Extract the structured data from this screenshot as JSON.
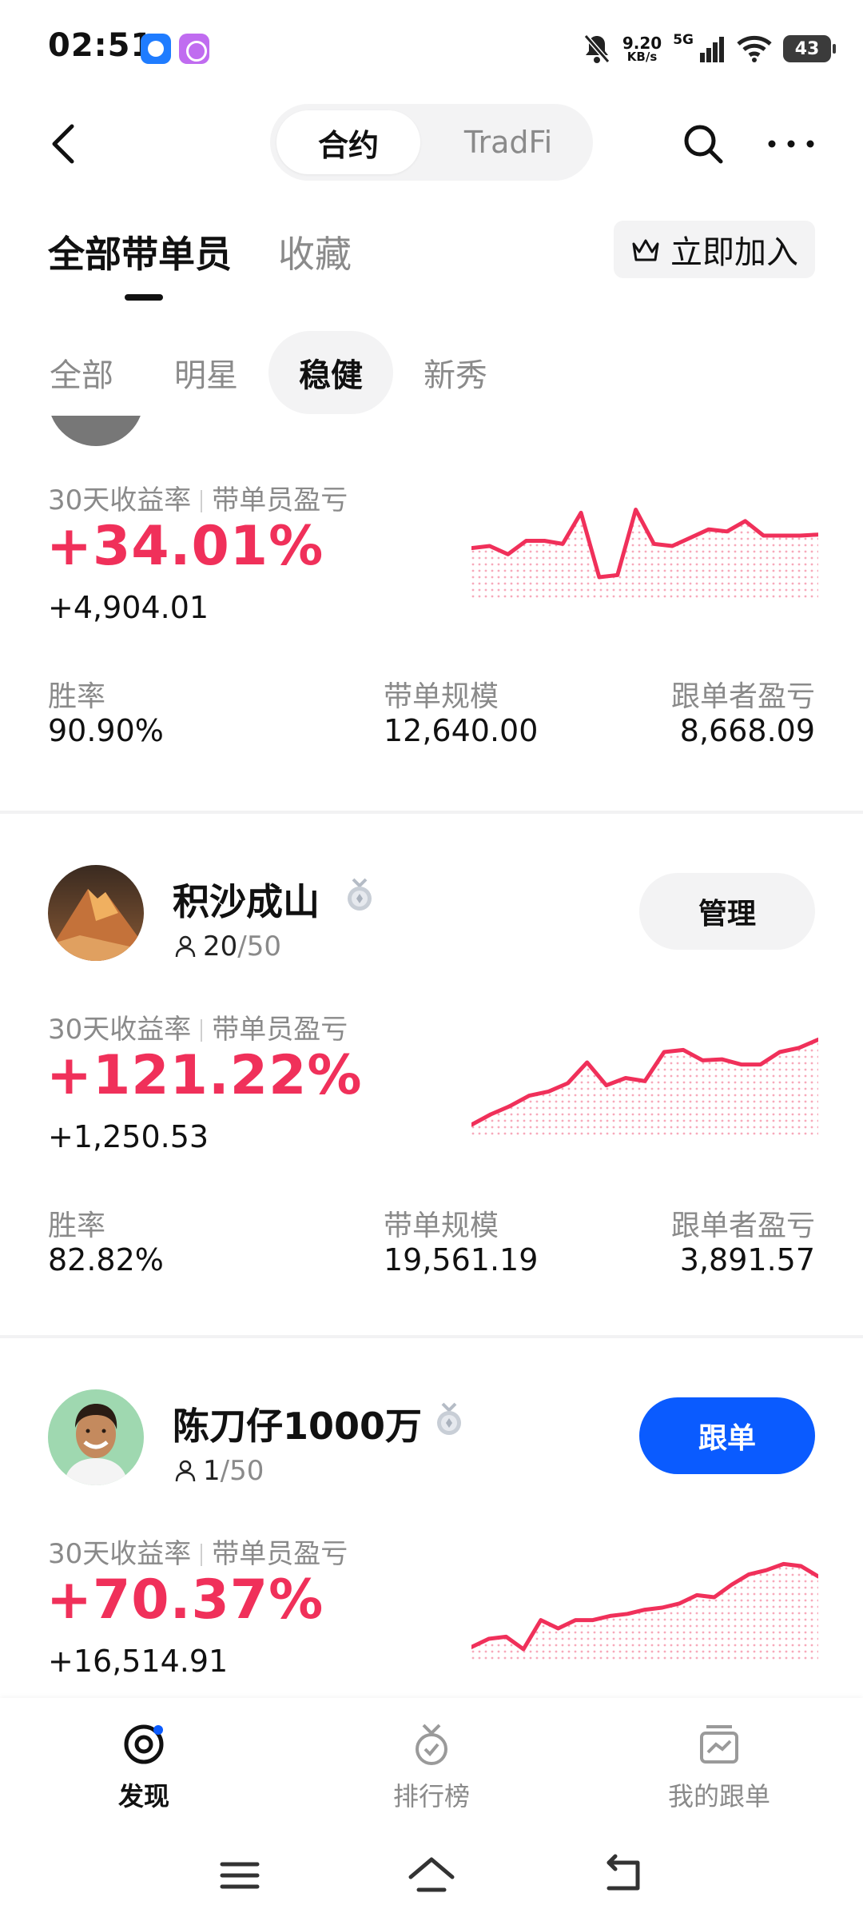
{
  "status_bar": {
    "time": "02:51",
    "net_speed_value": "9.20",
    "net_speed_unit": "KB/s",
    "network": "5G",
    "battery": "43"
  },
  "header": {
    "segments": [
      "合约",
      "TradFi"
    ],
    "active_segment": "合约"
  },
  "tabs": {
    "main": [
      "全部带单员",
      "收藏"
    ],
    "join_label": "立即加入"
  },
  "filters": [
    "全部",
    "明星",
    "稳健",
    "新秀"
  ],
  "labels": {
    "roi_label": "30天收益率",
    "pnl_label": "带单员盈亏",
    "win_rate": "胜率",
    "aum": "带单规模",
    "follower_pnl": "跟单者盈亏"
  },
  "traders": [
    {
      "roi": "+34.01%",
      "pnl": "+4,904.01",
      "win_rate": "90.90%",
      "aum": "12,640.00",
      "follower_pnl": "8,668.09",
      "spark": [
        52,
        50,
        58,
        45,
        45,
        48,
        18,
        80,
        78,
        15,
        48,
        50,
        42,
        34,
        36,
        26,
        40,
        40,
        40,
        39
      ]
    },
    {
      "name": "积沙成山",
      "followers": "20",
      "max_followers": "/50",
      "button": "管理",
      "roi": "+121.22%",
      "pnl": "+1,250.53",
      "win_rate": "82.82%",
      "aum": "19,561.19",
      "follower_pnl": "3,891.57",
      "spark": [
        90,
        80,
        72,
        62,
        58,
        50,
        30,
        52,
        45,
        48,
        20,
        18,
        28,
        27,
        32,
        32,
        20,
        16,
        8
      ]
    },
    {
      "name": "陈刀仔1000万",
      "followers": "1",
      "max_followers": "/50",
      "button": "跟单",
      "roi": "+70.37%",
      "pnl": "+16,514.91",
      "spark": [
        88,
        80,
        78,
        90,
        62,
        70,
        62,
        62,
        58,
        56,
        52,
        50,
        46,
        38,
        40,
        28,
        18,
        14,
        8,
        10,
        20
      ]
    }
  ],
  "bottom_nav": [
    {
      "label": "发现",
      "icon": "discover-icon"
    },
    {
      "label": "排行榜",
      "icon": "leaderboard-icon"
    },
    {
      "label": "我的跟单",
      "icon": "my-copy-icon"
    }
  ],
  "colors": {
    "accent_red": "#f0305a",
    "primary_blue": "#0a5bff"
  }
}
